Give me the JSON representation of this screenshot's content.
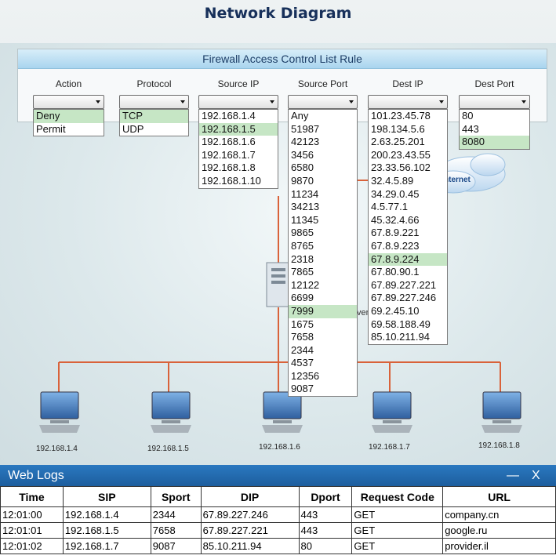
{
  "title": "Network Diagram",
  "firewall": {
    "header": "Firewall Access Control List Rule",
    "columns": [
      {
        "label": "Action",
        "options": [
          "Deny",
          "Permit"
        ],
        "selected": 0
      },
      {
        "label": "Protocol",
        "options": [
          "TCP",
          "UDP"
        ],
        "selected": 0
      },
      {
        "label": "Source IP",
        "options": [
          "192.168.1.4",
          "192.168.1.5",
          "192.168.1.6",
          "192.168.1.7",
          "192.168.1.8",
          "192.168.1.10"
        ],
        "selected": 1
      },
      {
        "label": "Source Port",
        "options": [
          "Any",
          "51987",
          "42123",
          "3456",
          "6580",
          "9870",
          "11234",
          "34213",
          "11345",
          "9865",
          "8765",
          "2318",
          "7865",
          "12122",
          "6699",
          "7999",
          "1675",
          "7658",
          "2344",
          "4537",
          "12356",
          "9087"
        ],
        "selected": 15
      },
      {
        "label": "Dest IP",
        "options": [
          "101.23.45.78",
          "198.134.5.6",
          "2.63.25.201",
          "200.23.43.55",
          "23.33.56.102",
          "32.4.5.89",
          "34.29.0.45",
          "4.5.77.1",
          "45.32.4.66",
          "67.8.9.221",
          "67.8.9.223",
          "67.8.9.224",
          "67.80.90.1",
          "67.89.227.221",
          "67.89.227.246",
          "69.2.45.10",
          "69.58.188.49",
          "85.10.211.94"
        ],
        "selected": 11
      },
      {
        "label": "Dest Port",
        "options": [
          "80",
          "443",
          "8080"
        ],
        "selected": 2
      }
    ]
  },
  "network": {
    "cloud_label": "nternet",
    "server_label": "ver",
    "pcs": [
      "192.168.1.4",
      "192.168.1.5",
      "192.168.1.6",
      "192.168.1.7",
      "192.168.1.8"
    ]
  },
  "logs": {
    "title": "Web Logs",
    "minimize": "—",
    "close": "X",
    "headers": [
      "Time",
      "SIP",
      "Sport",
      "DIP",
      "Dport",
      "Request Code",
      "URL"
    ],
    "rows": [
      [
        "12:01:00",
        "192.168.1.4",
        "2344",
        "67.89.227.246",
        "443",
        "GET",
        "company.cn"
      ],
      [
        "12:01:01",
        "192.168.1.5",
        "7658",
        "67.89.227.221",
        "443",
        "GET",
        "google.ru"
      ],
      [
        "12:01:02",
        "192.168.1.7",
        "9087",
        "85.10.211.94",
        "80",
        "GET",
        "provider.il"
      ]
    ]
  },
  "colors": {
    "selected_option": "#c6e6c5",
    "link_line": "#d9623a",
    "titlebar": "#2a78c0"
  }
}
